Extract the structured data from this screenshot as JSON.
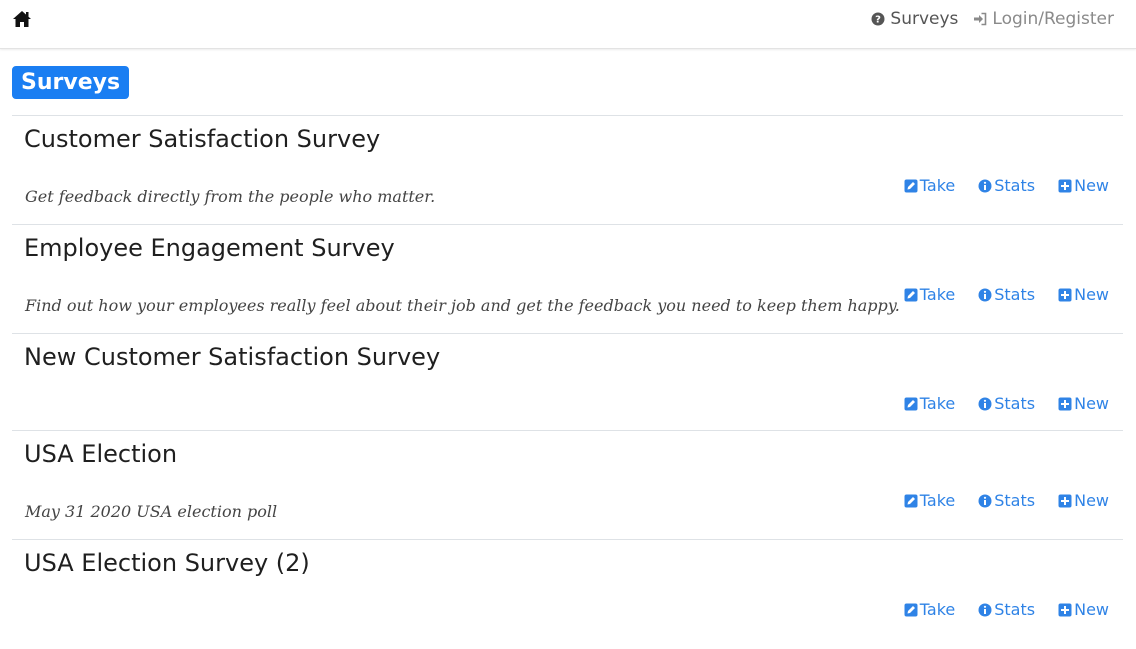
{
  "nav": {
    "home_icon": "home-icon",
    "surveys_label": "Surveys",
    "surveys_icon": "question-circle-icon",
    "login_label": "Login/Register",
    "login_icon": "sign-in-icon"
  },
  "page": {
    "badge": "Surveys",
    "accent_color": "#1a7ef2",
    "link_color": "#2f83e6"
  },
  "actions": {
    "take": "Take",
    "stats": "Stats",
    "new": "New"
  },
  "surveys": [
    {
      "title": "Customer Satisfaction Survey",
      "description": "Get feedback directly from the people who matter."
    },
    {
      "title": "Employee Engagement Survey",
      "description": "Find out how your employees really feel about their job and get the feedback you need to keep them happy."
    },
    {
      "title": "New Customer Satisfaction Survey",
      "description": ""
    },
    {
      "title": "USA Election",
      "description": "May 31 2020 USA election poll"
    },
    {
      "title": "USA Election Survey (2)",
      "description": ""
    }
  ]
}
